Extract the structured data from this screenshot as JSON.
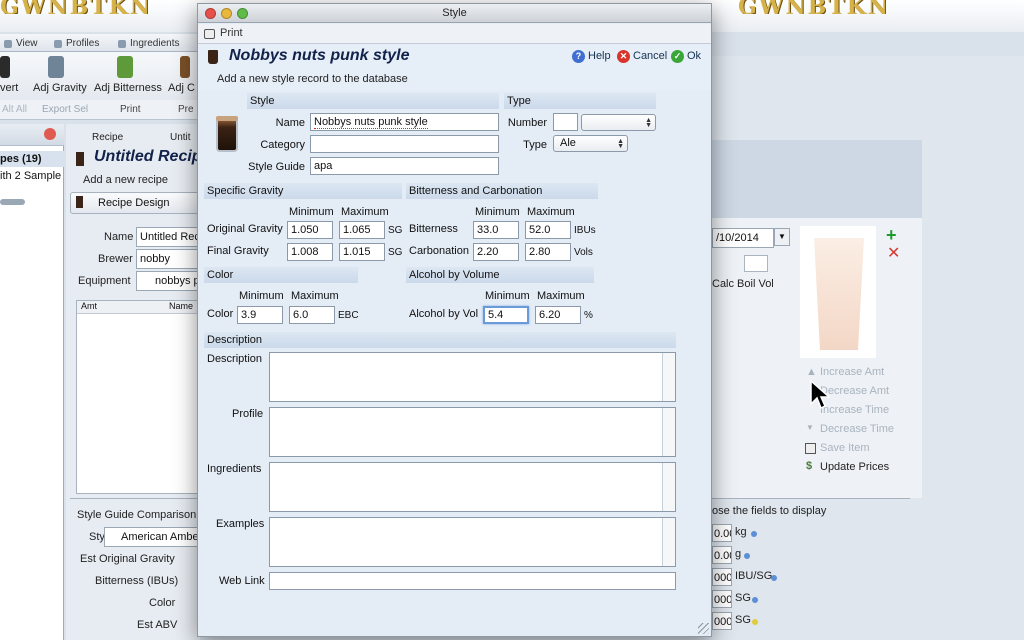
{
  "background": {
    "logo_left": "GWNBTKN",
    "logo_right": "GWNBTKN",
    "tabs": [
      "View",
      "Profiles",
      "Ingredients"
    ],
    "toolbar": [
      "vert",
      "Adj Gravity",
      "Adj Bitterness",
      "Adj C"
    ],
    "toolbar2": [
      "Alt All",
      "Export Sel",
      "Print",
      "Pre"
    ],
    "left_rows": [
      "pes (19)",
      "ith 2 Sample"
    ],
    "recipe_tabs": [
      "Recipe",
      "Untit"
    ],
    "recipe_title": "Untitled Recip",
    "recipe_sub": "Add a new recipe",
    "recipe_design": "Recipe Design",
    "fields": {
      "name_label": "Name",
      "name_value": "Untitled Rec",
      "brewer_label": "Brewer",
      "brewer_value": "nobby",
      "equipment_label": "Equipment",
      "equipment_value": "nobbys p"
    },
    "table_cols": [
      "Amt",
      "Name"
    ],
    "style_compare": {
      "title": "Style Guide Comparison",
      "style_label": "Style",
      "style_value": "American Ambe",
      "rows": [
        "Est Original Gravity",
        "Bitterness (IBUs)",
        "Color",
        "Est ABV"
      ]
    },
    "right": {
      "date": "/10/2014",
      "calc_boil_vol": "Calc Boil Vol",
      "actions": [
        "Increase Amt",
        "Decrease Amt",
        "Increase Time",
        "Decrease Time",
        "Save Item",
        "Update Prices"
      ],
      "choose_fields": "ose the fields to display",
      "unit_values": [
        "0.00",
        "0.00",
        "000",
        "000",
        "000"
      ],
      "units": [
        "kg",
        "g",
        "IBU/SG",
        "SG",
        "SG"
      ]
    }
  },
  "dialog": {
    "window_title": "Style",
    "print_label": "Print",
    "title": "Nobbys nuts punk style",
    "subtitle": "Add a new style record to the database",
    "help_label": "Help",
    "cancel_label": "Cancel",
    "ok_label": "Ok",
    "style": {
      "header": "Style",
      "name_label": "Name",
      "name_value": "Nobbys nuts punk style",
      "category_label": "Category",
      "category_value": "",
      "guide_label": "Style Guide",
      "guide_value": "apa"
    },
    "type": {
      "header": "Type",
      "number_label": "Number",
      "number_value": "",
      "number_select": "",
      "type_label": "Type",
      "type_value": "Ale"
    },
    "gravity": {
      "header": "Specific Gravity",
      "min_label": "Minimum",
      "max_label": "Maximum",
      "og_label": "Original Gravity",
      "og_min": "1.050",
      "og_max": "1.065",
      "og_unit": "SG",
      "fg_label": "Final Gravity",
      "fg_min": "1.008",
      "fg_max": "1.015",
      "fg_unit": "SG"
    },
    "bitterness": {
      "header": "Bitterness and Carbonation",
      "min_label": "Minimum",
      "max_label": "Maximum",
      "ibu_label": "Bitterness",
      "ibu_min": "33.0",
      "ibu_max": "52.0",
      "ibu_unit": "IBUs",
      "carb_label": "Carbonation",
      "carb_min": "2.20",
      "carb_max": "2.80",
      "carb_unit": "Vols"
    },
    "color": {
      "header": "Color",
      "min_label": "Minimum",
      "max_label": "Maximum",
      "label": "Color",
      "min": "3.9",
      "max": "6.0",
      "unit": "EBC"
    },
    "abv": {
      "header": "Alcohol by Volume",
      "min_label": "Minimum",
      "max_label": "Maximum",
      "label": "Alcohol by Vol",
      "min": "5.4",
      "max": "6.20",
      "unit": "%"
    },
    "description": {
      "header": "Description",
      "description_label": "Description",
      "profile_label": "Profile",
      "ingredients_label": "Ingredients",
      "examples_label": "Examples",
      "weblink_label": "Web Link"
    }
  },
  "colors": {
    "title_blue": "#12224a",
    "section_bg": "#cbd9ea",
    "focus_ring": "#6b9ad8"
  }
}
